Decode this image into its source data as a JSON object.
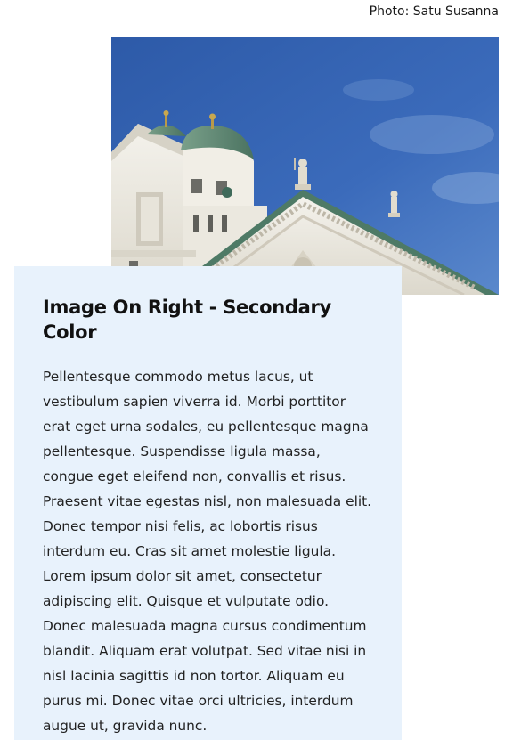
{
  "photo": {
    "credit": "Photo: Satu Susanna"
  },
  "card": {
    "title": "Image On Right - Secondary Color",
    "body": "Pellentesque commodo metus lacus, ut vestibulum sapien viverra id. Morbi porttitor erat eget urna sodales, eu pellentesque magna pellentesque. Suspendisse ligula massa, congue eget eleifend non, convallis et risus. Praesent vitae egestas nisl, non malesuada elit. Donec tempor nisi felis, ac lobortis risus interdum eu. Cras sit amet molestie ligula. Lorem ipsum dolor sit amet, consectetur adipiscing elit. Quisque et vulputate odio. Donec malesuada magna cursus condimentum blandit. Aliquam erat volutpat. Sed vitae nisi in nisl lacinia sagittis id non tortor. Aliquam eu purus mi. Donec vitae orci ultricies, interdum augue ut, gravida nunc."
  },
  "colors": {
    "card_background": "#e8f2fc",
    "sky": "#3a67b5",
    "dome": "#5f8a72",
    "building": "#efece4"
  }
}
